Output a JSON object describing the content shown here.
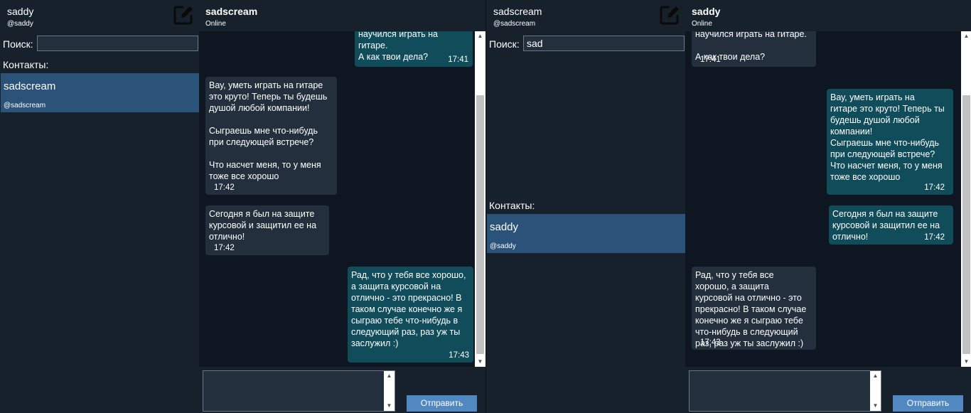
{
  "left": {
    "account_name": "saddy",
    "account_handle": "@saddy",
    "chat_name": "sadscream",
    "chat_status": "Online",
    "search_label": "Поиск:",
    "search_value": "",
    "contacts_label": "Контакты:",
    "contacts": [
      {
        "name": "sadscream",
        "handle": "@sadscream"
      }
    ],
    "messages": [
      {
        "dir": "out",
        "text": "научился играть на гитаре.\nА как твои дела?",
        "time": "17:41"
      },
      {
        "dir": "in",
        "text": "Вау, уметь играть на гитаре\nэто круто! Теперь ты будешь\nдушой любой компании!\n\nСыграешь мне что-нибудь\nпри следующей встрече?\n\nЧто насчет меня, то у меня\nтоже все хорошо",
        "time": "17:42"
      },
      {
        "dir": "in",
        "text": "Сегодня я был на защите\nкурсовой и защитил ее на\nотлично!",
        "time": "17:42"
      },
      {
        "dir": "out",
        "text": "Рад, что у тебя все хорошо,\nа защита курсовой на\nотлично - это прекрасно! В\nтаком случае конечно же я\nсыграю тебе что-нибудь в\nследующий раз, раз уж ты\nзаслужил :)",
        "time": "17:43"
      }
    ],
    "send_label": "Отправить"
  },
  "right": {
    "account_name": "sadscream",
    "account_handle": "@sadscream",
    "chat_name": "saddy",
    "chat_status": "Online",
    "search_label": "Поиск:",
    "search_value": "sad",
    "contacts_label": "Контакты:",
    "contacts": [
      {
        "name": "saddy",
        "handle": "@saddy"
      }
    ],
    "messages": [
      {
        "dir": "in",
        "text": "научился играть на гитаре.\n\nА как твои дела?",
        "time": "17:41"
      },
      {
        "dir": "out",
        "text": "Вау, уметь играть на\nгитаре это круто! Теперь ты\nбудешь душой любой\nкомпании!\nСыграешь мне что-нибудь\nпри следующей встрече?\nЧто насчет меня, то у меня\nтоже все хорошо",
        "time": "17:42"
      },
      {
        "dir": "out",
        "text": "Сегодня я был на защите\nкурсовой и защитил ее на\nотлично!",
        "time": "17:42"
      },
      {
        "dir": "in",
        "text": "Рад, что у тебя все\nхорошо, а защита\nкурсовой на отлично - это\nпрекрасно! В таком случае\nконечно же я сыграю тебе\nчто-нибудь в следующий\nраз, раз уж ты заслужил :)",
        "time": "17:43"
      }
    ],
    "send_label": "Отправить"
  },
  "icons": {
    "compose": "compose-icon",
    "scroll_up": "arrow-up-icon",
    "scroll_down": "arrow-down-icon"
  },
  "colors": {
    "sidebar": "#17212b",
    "chat_bg": "#0e1621",
    "bubble_in": "#242f3d",
    "bubble_out": "#104c5a",
    "selected_contact": "#2b5278",
    "send_button": "#5288c1"
  }
}
